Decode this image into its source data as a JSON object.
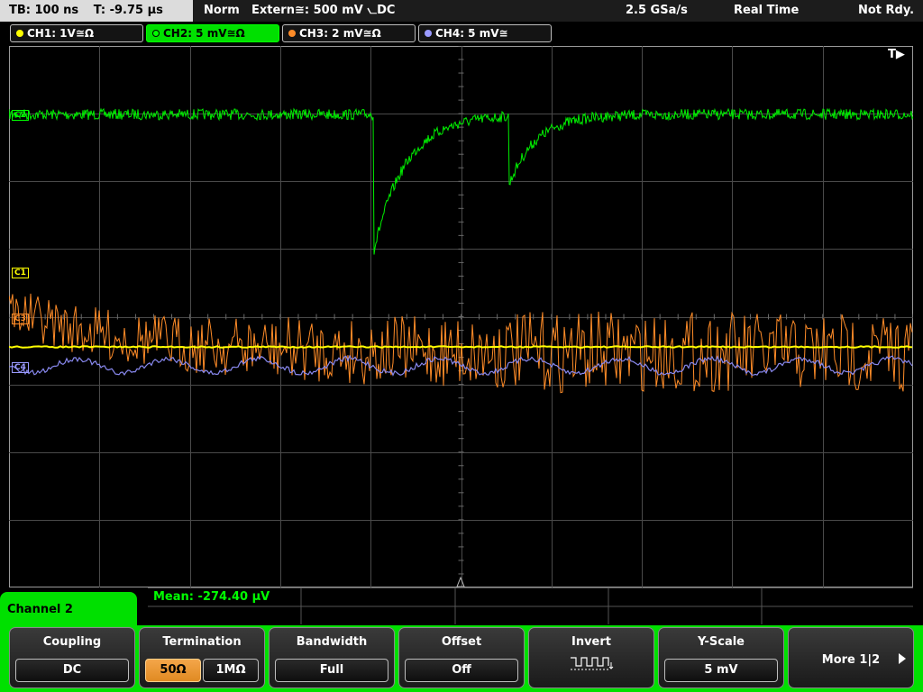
{
  "topbar": {
    "timebase": "TB: 100 ns",
    "trigger_time": "T: -9.75 µs",
    "mode": "Norm",
    "trigger_source": "Extern≅: 500 mV ⦦DC",
    "sample_rate": "2.5 GSa/s",
    "acq_mode": "Real Time",
    "status": "Not Rdy."
  },
  "channels": [
    {
      "label": "CH1: 1V≅Ω",
      "color": "#ffff00"
    },
    {
      "label": "CH2: 5 mV≅Ω",
      "color": "#00ff00"
    },
    {
      "label": "CH3: 2 mV≅Ω",
      "color": "#ff8c28"
    },
    {
      "label": "CH4: 5 mV≅",
      "color": "#9a9aff"
    }
  ],
  "markers": {
    "trigger_pos": "T▶",
    "c2": "C2",
    "c1": "C1",
    "c3": "C3",
    "c4": "C4"
  },
  "measurement": {
    "mean": "Mean: -274.40 µV"
  },
  "menu": {
    "title": "Channel 2",
    "coupling": {
      "label": "Coupling",
      "value": "DC"
    },
    "termination": {
      "label": "Termination",
      "option1": "50Ω",
      "option2": "1MΩ",
      "selected": "50Ω"
    },
    "bandwidth": {
      "label": "Bandwidth",
      "value": "Full"
    },
    "offset": {
      "label": "Offset",
      "value": "Off"
    },
    "invert": {
      "label": "Invert",
      "icon": "square-wave-icon"
    },
    "yscale": {
      "label": "Y-Scale",
      "value": "5 mV"
    },
    "more": {
      "label": "More 1|2"
    }
  }
}
